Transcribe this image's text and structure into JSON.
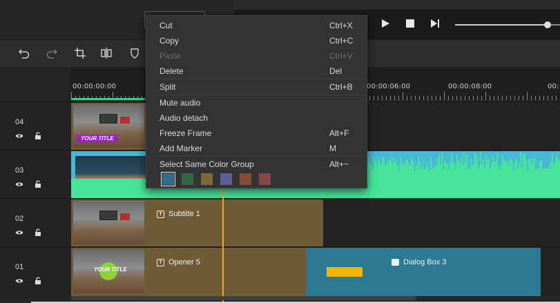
{
  "tracks": [
    {
      "label": "04"
    },
    {
      "label": "03"
    },
    {
      "label": "02"
    },
    {
      "label": "01"
    }
  ],
  "ruler": {
    "ticks": [
      "00:00:00:00",
      "00:00:06:00",
      "00:00:08:00",
      "00:"
    ]
  },
  "clips": {
    "track04_badge": "YOUR TITLE",
    "subtitle": "Subtitle 1",
    "opener": "Opener 5",
    "opener_badge": "YOUR TITLE",
    "dialog": "Dialog Box 3"
  },
  "context_menu": {
    "items": [
      {
        "label": "Cut",
        "shortcut": "Ctrl+X"
      },
      {
        "label": "Copy",
        "shortcut": "Ctrl+C"
      },
      {
        "label": "Paste",
        "shortcut": "Ctrl+V",
        "disabled": true
      },
      {
        "label": "Delete",
        "shortcut": "Del"
      },
      {
        "label": "Split",
        "shortcut": "Ctrl+B"
      },
      {
        "label": "Mute audio",
        "shortcut": ""
      },
      {
        "label": "Audio detach",
        "shortcut": ""
      },
      {
        "label": "Freeze Frame",
        "shortcut": "Alt+F"
      },
      {
        "label": "Add Marker",
        "shortcut": "M"
      },
      {
        "label": "Select Same Color Group",
        "shortcut": "Alt+~"
      }
    ],
    "color_swatches": [
      "#2f6f8e",
      "#2f6a45",
      "#7a6a35",
      "#5a5f9a",
      "#8a4a38",
      "#8a4545"
    ]
  },
  "colors": {
    "clip_tan": "#6e5c37",
    "clip_teal": "#2b7a92",
    "clip_audio": "#49b8d7",
    "waveform": "#45e49a",
    "playhead": "#f2a81d"
  },
  "icons": {
    "playback": [
      "play-icon",
      "stop-icon",
      "next-frame-icon"
    ],
    "toolbar": [
      "undo-icon",
      "redo-icon",
      "crop-icon",
      "split-mirror-icon",
      "shield-icon"
    ],
    "track": [
      "eye-icon",
      "lock-icon"
    ]
  }
}
